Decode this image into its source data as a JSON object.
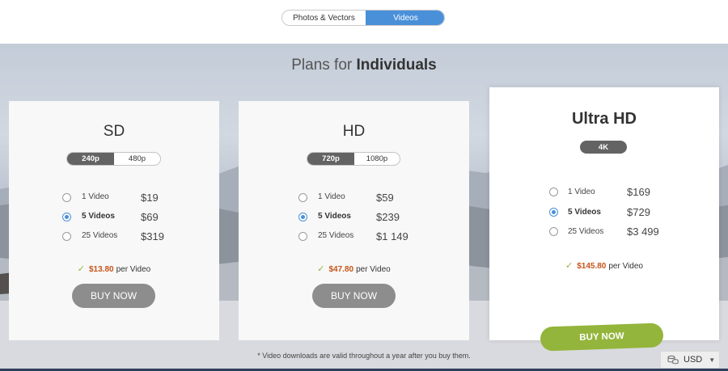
{
  "type_toggle": {
    "options": [
      "Photos & Vectors",
      "Videos"
    ],
    "active": "Videos"
  },
  "hero": {
    "title_prefix": "Plans for ",
    "title_bold": "Individuals"
  },
  "plans": [
    {
      "title": "SD",
      "resolutions": [
        "240p",
        "480p"
      ],
      "active_resolution": "240p",
      "options": [
        {
          "qty": "1 Video",
          "price": "$19",
          "selected": false
        },
        {
          "qty": "5 Videos",
          "price": "$69",
          "selected": true
        },
        {
          "qty": "25 Videos",
          "price": "$319",
          "selected": false
        }
      ],
      "per_amount": "$13.80",
      "per_label": "per Video",
      "button": "BUY NOW"
    },
    {
      "title": "HD",
      "resolutions": [
        "720p",
        "1080p"
      ],
      "active_resolution": "720p",
      "options": [
        {
          "qty": "1 Video",
          "price": "$59",
          "selected": false
        },
        {
          "qty": "5 Videos",
          "price": "$239",
          "selected": true
        },
        {
          "qty": "25 Videos",
          "price": "$1 149",
          "selected": false
        }
      ],
      "per_amount": "$47.80",
      "per_label": "per Video",
      "button": "BUY NOW"
    },
    {
      "title": "Ultra HD",
      "resolutions": [
        "4K"
      ],
      "active_resolution": "4K",
      "options": [
        {
          "qty": "1 Video",
          "price": "$169",
          "selected": false
        },
        {
          "qty": "5 Videos",
          "price": "$729",
          "selected": true
        },
        {
          "qty": "25 Videos",
          "price": "$3 499",
          "selected": false
        }
      ],
      "per_amount": "$145.80",
      "per_label": "per Video",
      "button": "BUY NOW"
    }
  ],
  "footnote": "* Video downloads are valid throughout a year after you buy them.",
  "currency": {
    "label": "USD",
    "icon": "coins-icon"
  },
  "colors": {
    "accent_blue": "#4a90d9",
    "buy_green": "#93b53b",
    "buy_grey": "#8d8d8d",
    "price_orange": "#c7541a",
    "check_green": "#93b53b"
  }
}
